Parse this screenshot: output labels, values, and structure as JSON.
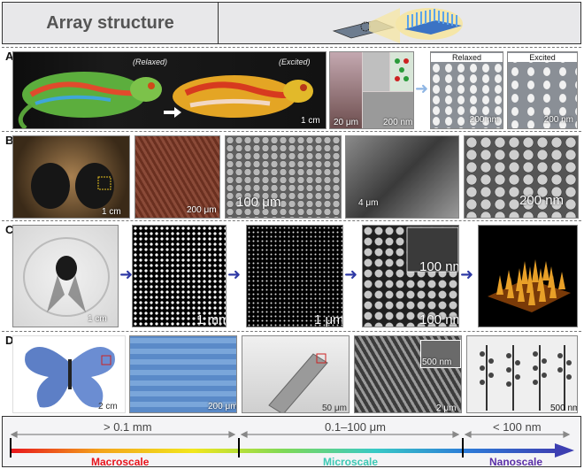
{
  "header": {
    "title": "Array structure"
  },
  "panels": {
    "A": {
      "label": "A",
      "relaxed_italic": "(Relaxed)",
      "excited_italic": "(Excited)",
      "scalebar_chameleon": "1 cm",
      "scalebar_micro_1": "20 μm",
      "scalebar_micro_2": "200 nm",
      "relaxed_title": "Relaxed",
      "excited_title": "Excited",
      "scalebar_relaxed": "200 nm",
      "scalebar_excited": "200 nm"
    },
    "B": {
      "label": "B",
      "sb1": "1 cm",
      "sb2": "200 μm",
      "sb3": "100 μm",
      "sb4": "4 μm",
      "sb5": "200 nm"
    },
    "C": {
      "label": "C",
      "sb1": "1 cm",
      "sb2": "1 mm",
      "sb3": "1 μm",
      "sb4a": "100 nm",
      "sb4b": "100 nm"
    },
    "D": {
      "label": "D",
      "sb1": "2 cm",
      "sb2": "200 μm",
      "sb3": "50 μm",
      "sb4": "2 μm",
      "sb4inset": "500 nm",
      "sb5": "500 nm"
    }
  },
  "scale": {
    "range_macro": "> 0.1 mm",
    "range_micro": "0.1–100 μm",
    "range_nano": "< 100 nm",
    "macro_label": "Macroscale",
    "micro_label": "Microscale",
    "nano_label": "Nanoscale",
    "macro_color": "#e8141c",
    "micro_color": "#3cc9b4",
    "nano_color": "#5b2fa8"
  }
}
